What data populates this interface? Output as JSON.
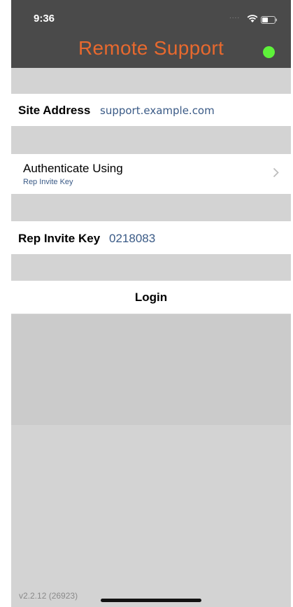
{
  "status_bar": {
    "time": "9:36",
    "signal_dots": "....",
    "wifi_icon": "wifi-icon",
    "battery_icon": "battery-icon"
  },
  "header": {
    "title": "Remote Support",
    "connection_color": "#5ef23a",
    "title_color": "#e8692e"
  },
  "form": {
    "site_address_label": "Site Address",
    "site_address_value": "support.example.com",
    "authenticate_label": "Authenticate Using",
    "authenticate_value": "Rep Invite Key",
    "rep_key_label": "Rep Invite Key",
    "rep_key_value": "0218083",
    "login_label": "Login"
  },
  "footer": {
    "version": "v2.2.12 (26923)"
  }
}
